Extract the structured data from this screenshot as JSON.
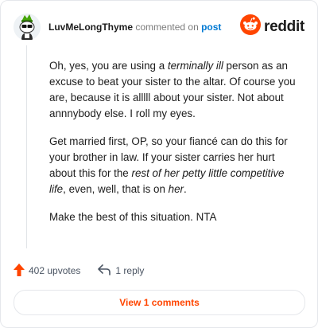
{
  "comment": {
    "username": "LuvMeLongThyme",
    "action_text": "commented on",
    "post_link": "post",
    "brand": "reddit",
    "paragraphs": {
      "p1": [
        "Oh, yes, you are using a ",
        "terminally ill",
        " person as an excuse to beat your sister to the altar. Of course you are, because it is alllll about your sister. Not about annnybody else. I roll my eyes."
      ],
      "p2": [
        "Get married first, OP, so your fiancé can do this for your brother in law. If your sister carries her hurt about this for the ",
        "rest of her petty little competitive life",
        ", even, well, that is on ",
        "her",
        "."
      ],
      "p3": "Make the best of this situation. NTA"
    }
  },
  "footer": {
    "upvotes": "402 upvotes",
    "replies": "1 reply",
    "view_comments": "View 1 comments"
  },
  "colors": {
    "accent": "#ff4500",
    "link": "#0079d3",
    "avatar_accent": "#46a508"
  },
  "icons": {
    "avatar": "snoo-avatar-icon",
    "brand": "reddit-logo-icon",
    "upvote": "upvote-arrow-icon",
    "reply": "reply-arrow-icon"
  }
}
